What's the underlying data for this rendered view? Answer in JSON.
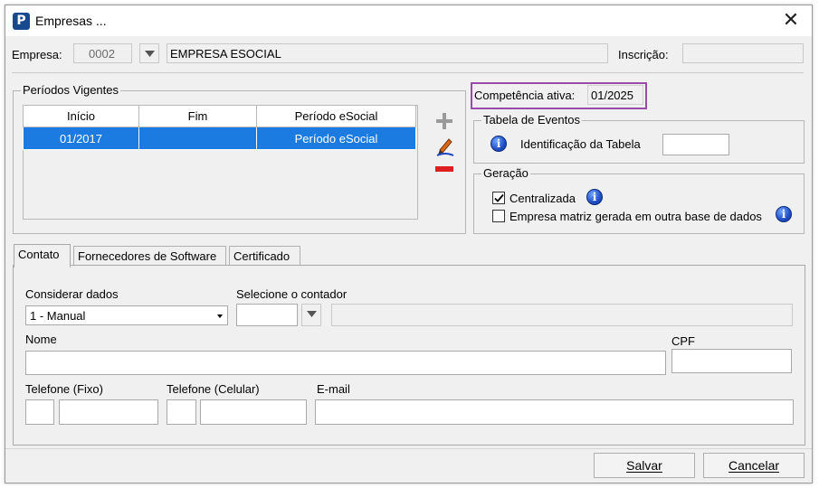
{
  "window": {
    "title": "Empresas ...",
    "close_glyph": "✕",
    "app_icon_letter": "P"
  },
  "header": {
    "empresa_label": "Empresa:",
    "empresa_code": "0002",
    "empresa_name": "EMPRESA ESOCIAL",
    "inscricao_label": "Inscrição:",
    "inscricao_value": ""
  },
  "periodos": {
    "title": "Períodos Vigentes",
    "columns": [
      "Início",
      "Fim",
      "Período eSocial"
    ],
    "rows": [
      {
        "inicio": "01/2017",
        "fim": "",
        "periodo": "Período eSocial"
      }
    ]
  },
  "competencia": {
    "label": "Competência ativa:",
    "value": "01/2025"
  },
  "tabela_eventos": {
    "title": "Tabela de Eventos",
    "identificacao_label": "Identificação da Tabela",
    "identificacao_value": ""
  },
  "geracao": {
    "title": "Geração",
    "centralizada_label": "Centralizada",
    "centralizada_checked": true,
    "matriz_label": "Empresa matriz gerada em outra base de dados",
    "matriz_checked": false
  },
  "tabs": [
    {
      "label": "Contato",
      "active": true
    },
    {
      "label": "Fornecedores de Software",
      "active": false
    },
    {
      "label": "Certificado",
      "active": false
    }
  ],
  "contato": {
    "considerar_label": "Considerar dados",
    "considerar_value": "1 - Manual",
    "contador_label": "Selecione o contador",
    "contador_code": "",
    "contador_name": "",
    "nome_label": "Nome",
    "nome_value": "",
    "cpf_label": "CPF",
    "cpf_value": "",
    "telefone_fixo_label": "Telefone (Fixo)",
    "telefone_celular_label": "Telefone (Celular)",
    "email_label": "E-mail"
  },
  "buttons": {
    "salvar": "Salvar",
    "cancelar": "Cancelar"
  },
  "colors": {
    "selection": "#1b7be0",
    "highlight": "#9a4aa8",
    "plus": "#9a9a9a",
    "minus": "#e02020"
  },
  "icons": [
    "app-logo-icon",
    "close-icon",
    "dropdown-arrow-icon",
    "add-icon",
    "edit-icon",
    "remove-icon",
    "info-icon",
    "checkbox-check-icon"
  ]
}
